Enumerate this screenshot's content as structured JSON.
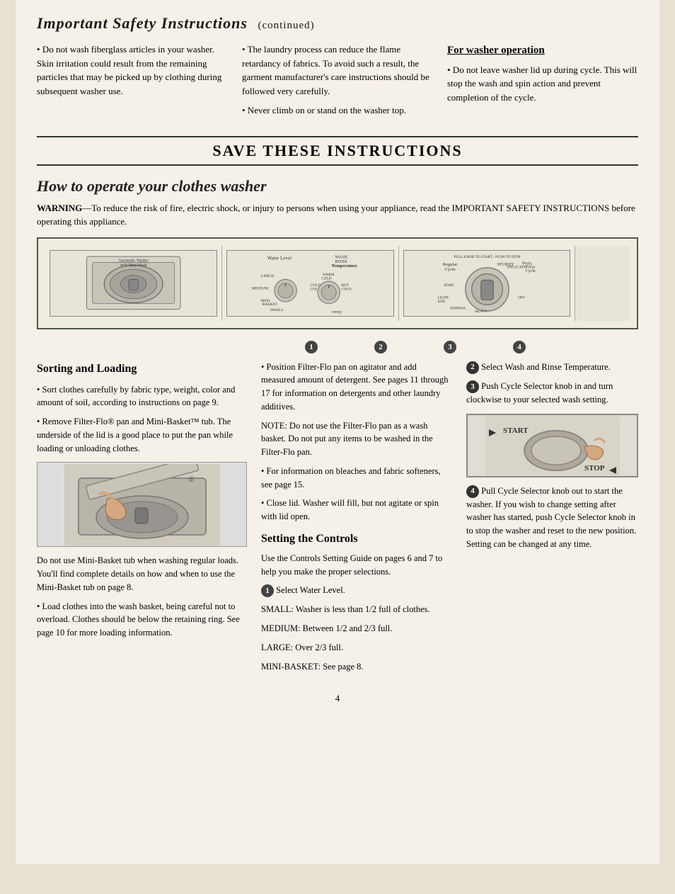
{
  "page": {
    "number": "4"
  },
  "header": {
    "title": "Important Safety Instructions",
    "continued": "(continued)"
  },
  "safety": {
    "col1": {
      "text": "• Do not wash fiberglass articles in your washer. Skin irritation could result from the remaining particles that may be picked up by clothing during subsequent washer use."
    },
    "col2": {
      "para1": "• The laundry process can reduce the flame retardancy of fabrics. To avoid such a result, the garment manufacturer's care instructions should be followed very carefully.",
      "para2": "• Never climb on or stand on the washer top."
    },
    "col3": {
      "title": "For washer operation",
      "text": "• Do not leave washer lid up during cycle. This will stop the wash and spin action and prevent completion of the cycle."
    }
  },
  "save_instructions": "SAVE THESE INSTRUCTIONS",
  "how_to": {
    "title": "How to operate your clothes washer",
    "warning": "WARNING—To reduce the risk of fire, electric shock, or injury to persons when using your appliance, read the IMPORTANT SAFETY INSTRUCTIONS before operating this appliance."
  },
  "diagram": {
    "panel1_label": "Automatic Washer\nwith Mini-Wash",
    "panel2_label1": "Water Level",
    "panel2_label2": "Temperature",
    "step_numbers": [
      "1",
      "2",
      "3",
      "4"
    ]
  },
  "sorting": {
    "title": "Sorting and Loading",
    "para1": "• Sort clothes carefully by fabric type, weight, color and amount of soil, according to instructions on page 9.",
    "para2": "• Remove Filter-Flo® pan and Mini-Basket™ tub. The underside of the lid is a good place to put the pan while loading or unloading clothes.",
    "para3": "Do not use Mini-Basket tub when washing regular loads. You'll find complete details on how and when to use the Mini-Basket tub on page 8.",
    "para4": "• Load clothes into the wash basket, being careful not to overload. Clothes should be below the retaining ring. See page 10 for more loading information."
  },
  "mid_col": {
    "para1": "• Position Filter-Flo pan on agitator and add measured amount of detergent. See pages 11 through 17 for information on detergents and other laundry additives.",
    "note": "NOTE: Do not use the Filter-Flo pan as a wash basket. Do not put any items to be washed in the Filter-Flo pan.",
    "para2": "• For information on bleaches and fabric softeners, see page 15.",
    "para3": "• Close lid. Washer will fill, but not agitate or spin with lid open.",
    "setting_title": "Setting the Controls",
    "setting_para": "Use the Controls Setting Guide on pages 6 and 7 to help you make the proper selections.",
    "step1_label": "Select Water Level.",
    "small_label": "SMALL: Washer is less than 1/2 full of clothes.",
    "medium_label": "MEDIUM: Between 1/2 and 2/3 full.",
    "large_label": "LARGE: Over 2/3 full.",
    "mini_label": "MINI-BASKET: See page 8."
  },
  "right_col": {
    "step2": "Select Wash and Rinse Temperature.",
    "step3": "Push Cycle Selector knob in and turn clockwise to your selected wash setting.",
    "start_label": "START",
    "stop_label": "STOP",
    "step4": "Pull Cycle Selector knob out to start the washer. If you wish to change setting after washer has started, push Cycle Selector knob in to stop the washer and reset to the new position. Setting can be changed at any time."
  }
}
